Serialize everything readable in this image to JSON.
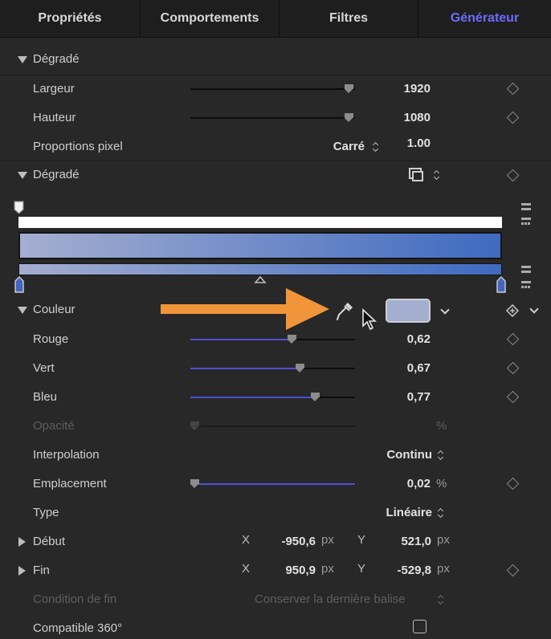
{
  "tabs": [
    "Propriétés",
    "Comportements",
    "Filtres",
    "Générateur"
  ],
  "sections": {
    "gradient_params": "Dégradé",
    "gradient_editor": "Dégradé",
    "color": "Couleur"
  },
  "rows": {
    "width": {
      "label": "Largeur",
      "value": "1920",
      "slider": 0.85
    },
    "height": {
      "label": "Hauteur",
      "value": "1080",
      "slider": 0.85
    },
    "pixel_aspect": {
      "label": "Proportions pixel",
      "selected": "Carré",
      "value": "1.00"
    },
    "red": {
      "label": "Rouge",
      "value": "0,62",
      "slider": 0.62
    },
    "green": {
      "label": "Vert",
      "value": "0,67",
      "slider": 0.67
    },
    "blue": {
      "label": "Bleu",
      "value": "0,77",
      "slider": 0.77
    },
    "opacity": {
      "label": "Opacité",
      "unit": "%"
    },
    "interpolation": {
      "label": "Interpolation",
      "selected": "Continu"
    },
    "location": {
      "label": "Emplacement",
      "value": "0,02",
      "unit": "%",
      "slider": 0.02
    },
    "type": {
      "label": "Type",
      "selected": "Linéaire"
    },
    "start": {
      "label": "Début",
      "x_axis": "X",
      "x": "-950,6",
      "x_unit": "px",
      "y_axis": "Y",
      "y": "521,0",
      "y_unit": "px"
    },
    "end": {
      "label": "Fin",
      "x_axis": "X",
      "x": "950,9",
      "x_unit": "px",
      "y_axis": "Y",
      "y": "-529,8",
      "y_unit": "px"
    },
    "end_condition": {
      "label": "Condition de fin",
      "selected": "Conserver la dernière balise"
    },
    "compat360": {
      "label": "Compatible 360°",
      "checked": false
    }
  },
  "colors": {
    "accent": "#6e6cff",
    "slider_fill": "#4f4fd6",
    "gradient_start": "#a4aed0",
    "gradient_end": "#3e6ac0",
    "swatch": "#a4aed0",
    "arrow": "#f0953a"
  },
  "icons": {
    "eyedropper": "eyedropper-icon",
    "pointer": "mouse-pointer-icon",
    "keyframe": "keyframe-diamond-icon",
    "preset": "gradient-preset-icon"
  }
}
